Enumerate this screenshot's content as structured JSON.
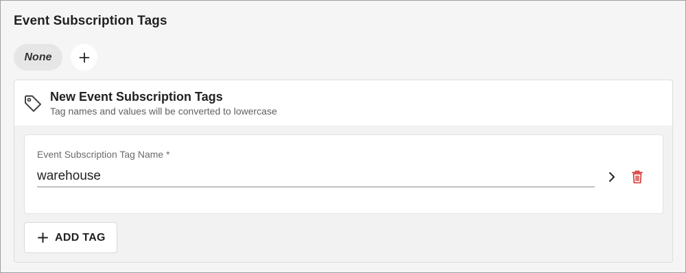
{
  "section": {
    "title": "Event Subscription Tags",
    "chip_label": "None",
    "add_icon": "plus-icon"
  },
  "panel": {
    "icon": "tag-icon",
    "title": "New Event Subscription Tags",
    "subtitle": "Tag names and values will be converted to lowercase"
  },
  "tag_card": {
    "field_label": "Event Subscription Tag Name *",
    "field_value": "warehouse",
    "expand_icon": "chevron-right-icon",
    "delete_icon": "trash-icon",
    "delete_color": "#d32f2f"
  },
  "add_tag": {
    "label": "ADD TAG",
    "icon": "plus-icon"
  }
}
